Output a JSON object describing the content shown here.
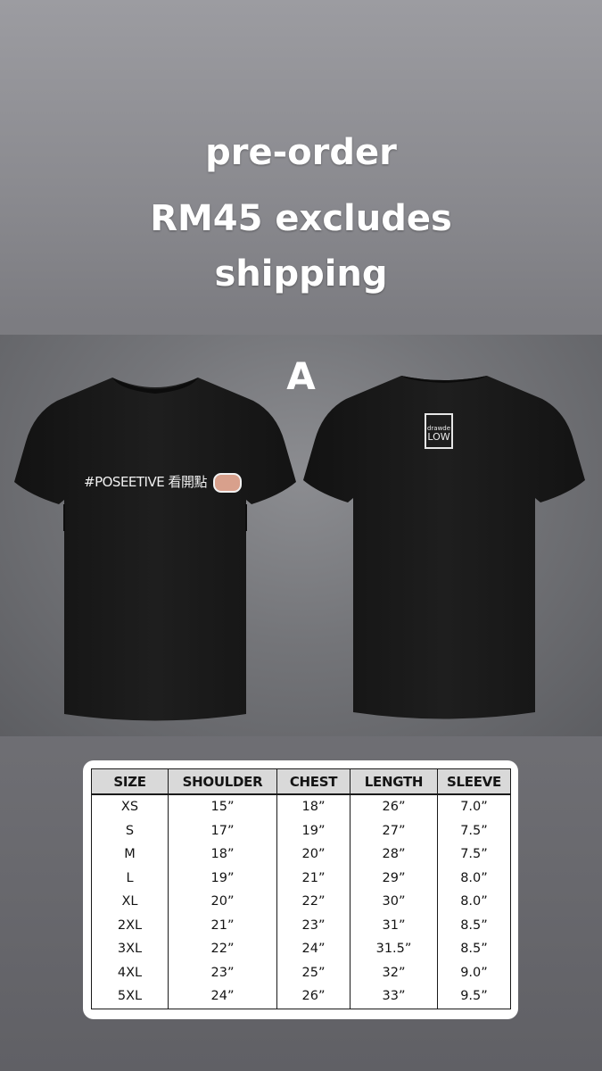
{
  "headline": {
    "line1": "pre-order",
    "line2": "RM45 excludes",
    "line3": "shipping"
  },
  "product": {
    "variant_label": "A",
    "front_print_text": "#POSEETIVE 看開點",
    "back_logo_top": "drawde",
    "back_logo_bottom": "LOW",
    "shirt_color": "#1a1a1a"
  },
  "size_chart": {
    "headers": [
      "SIZE",
      "SHOULDER",
      "CHEST",
      "LENGTH",
      "SLEEVE"
    ],
    "rows": [
      [
        "XS",
        "15”",
        "18”",
        "26”",
        "7.0”"
      ],
      [
        "S",
        "17”",
        "19”",
        "27”",
        "7.5”"
      ],
      [
        "M",
        "18”",
        "20”",
        "28”",
        "7.5”"
      ],
      [
        "L",
        "19”",
        "21”",
        "29”",
        "8.0”"
      ],
      [
        "XL",
        "20”",
        "22”",
        "30”",
        "8.0”"
      ],
      [
        "2XL",
        "21”",
        "23”",
        "31”",
        "8.5”"
      ],
      [
        "3XL",
        "22”",
        "24”",
        "31.5”",
        "8.5”"
      ],
      [
        "4XL",
        "23”",
        "25”",
        "32”",
        "9.0”"
      ],
      [
        "5XL",
        "24”",
        "26”",
        "33”",
        "9.5”"
      ]
    ]
  }
}
